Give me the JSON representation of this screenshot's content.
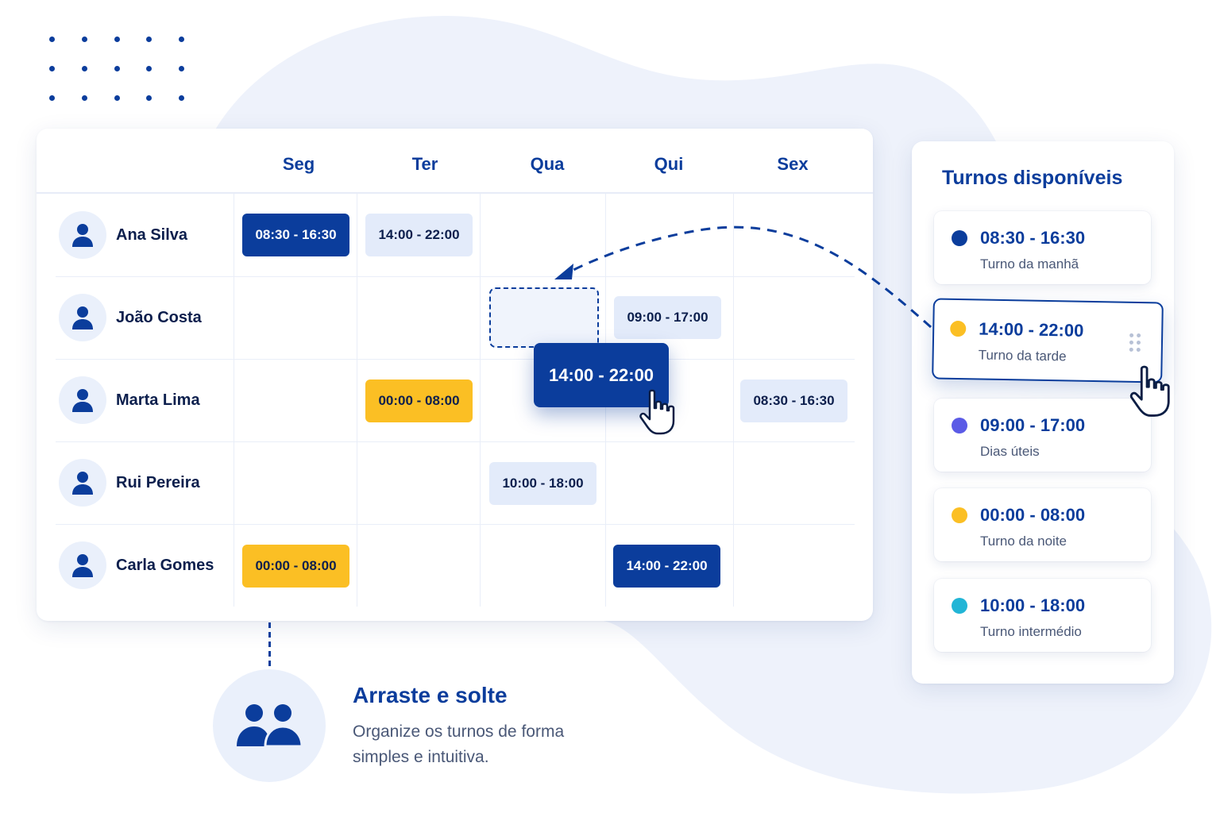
{
  "schedule": {
    "days": [
      "Seg",
      "Ter",
      "Qua",
      "Qui",
      "Sex"
    ],
    "people": [
      {
        "name": "Ana Silva"
      },
      {
        "name": "João Costa"
      },
      {
        "name": "Marta Lima"
      },
      {
        "name": "Rui Pereira"
      },
      {
        "name": "Carla Gomes"
      }
    ],
    "shifts": [
      {
        "person": "Ana Silva",
        "day": "Seg",
        "time": "08:30 - 16:30",
        "style": "dark"
      },
      {
        "person": "Ana Silva",
        "day": "Ter",
        "time": "14:00 - 22:00",
        "style": "light"
      },
      {
        "person": "João Costa",
        "day": "Qui",
        "time": "09:00 - 17:00",
        "style": "light"
      },
      {
        "person": "Marta Lima",
        "day": "Ter",
        "time": "00:00 - 08:00",
        "style": "yellow"
      },
      {
        "person": "Marta Lima",
        "day": "Sex",
        "time": "08:30 - 16:30",
        "style": "light"
      },
      {
        "person": "Rui Pereira",
        "day": "Qua",
        "time": "10:00 - 18:00",
        "style": "light"
      },
      {
        "person": "Carla Gomes",
        "day": "Seg",
        "time": "00:00 - 08:00",
        "style": "yellow"
      },
      {
        "person": "Carla Gomes",
        "day": "Qui",
        "time": "14:00 - 22:00",
        "style": "dark"
      }
    ],
    "dragging_shift": "14:00 - 22:00"
  },
  "panel": {
    "title": "Turnos disponíveis",
    "options": [
      {
        "time": "08:30 - 16:30",
        "label": "Turno da manhã",
        "color": "#0b3d9c"
      },
      {
        "time": "14:00 - 22:00",
        "label": "Turno da tarde",
        "color": "#fbbf24",
        "selected": true
      },
      {
        "time": "09:00 - 17:00",
        "label": "Dias úteis",
        "color": "#5b5be6"
      },
      {
        "time": "00:00 - 08:00",
        "label": "Turno da noite",
        "color": "#fbbf24"
      },
      {
        "time": "10:00 - 18:00",
        "label": "Turno intermédio",
        "color": "#22b5d6"
      }
    ]
  },
  "feature": {
    "title": "Arraste e solte",
    "description": "Organize os turnos de forma simples e intuitiva."
  },
  "colors": {
    "primary": "#0b3d9c",
    "accent_yellow": "#fbbf24",
    "light_blue": "#e3ebfa"
  }
}
